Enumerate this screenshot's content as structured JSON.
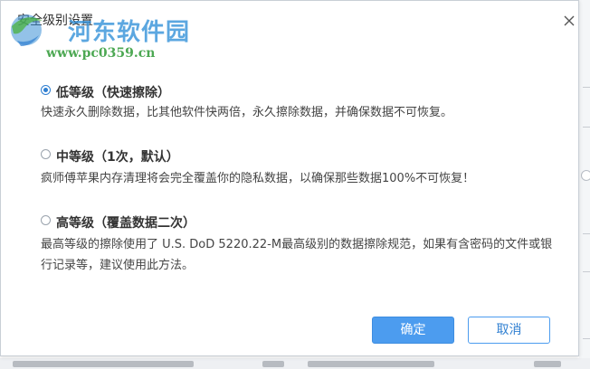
{
  "window": {
    "title": "安全级别设置"
  },
  "watermark": {
    "name": "河东软件园",
    "url": "www.pc0359.cn"
  },
  "options": [
    {
      "label": "低等级（快速擦除）",
      "description": "快速永久删除数据，比其他软件快两倍，永久擦除数据，并确保数据不可恢复。",
      "checked": true
    },
    {
      "label": "中等级（1次，默认）",
      "description": "疯师傅苹果内存清理将会完全覆盖你的隐私数据，以确保那些数据100%不可恢复！",
      "checked": false
    },
    {
      "label": "高等级（覆盖数据二次）",
      "description": "最高等级的擦除使用了 U.S. DoD 5220.22-M最高级别的数据擦除规范，如果有含密码的文件或银行记录等，建议使用此方法。",
      "checked": false
    }
  ],
  "buttons": {
    "ok": "确定",
    "cancel": "取消"
  },
  "colors": {
    "accent": "#4c9cef",
    "watermark_blue": "#2f8fd8",
    "watermark_green": "#2e9a36"
  },
  "icons": {
    "close": "close-icon",
    "watermark_logo": "watermark-logo-icon"
  }
}
